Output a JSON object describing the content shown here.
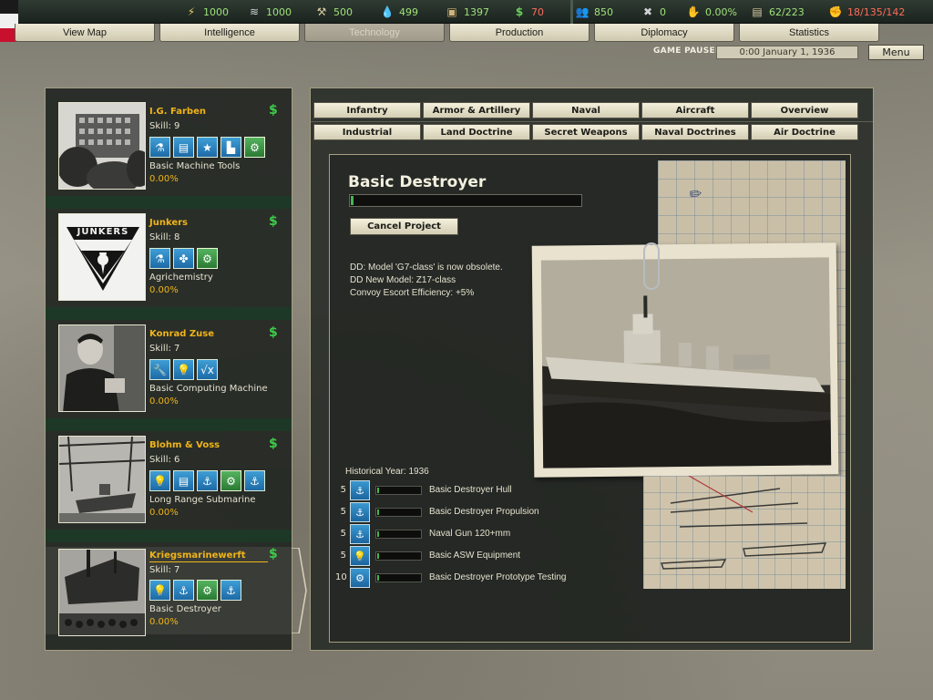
{
  "topbar": {
    "resources": [
      {
        "icon": "energy-icon",
        "value": "1000"
      },
      {
        "icon": "metal-icon",
        "value": "1000"
      },
      {
        "icon": "rare-materials-icon",
        "value": "500"
      },
      {
        "icon": "oil-icon",
        "value": "499"
      },
      {
        "icon": "supplies-icon",
        "value": "1397"
      },
      {
        "icon": "money-icon",
        "value": "70"
      },
      {
        "icon": "manpower-icon",
        "value": "850"
      },
      {
        "icon": "diplomacy-icon",
        "value": "0"
      },
      {
        "icon": "dissent-icon",
        "value": "0.00%"
      },
      {
        "icon": "transports-icon",
        "value": "62/223"
      },
      {
        "icon": "industry-icon",
        "value": "18/135/142"
      }
    ]
  },
  "tabs": [
    "View Map",
    "Intelligence",
    "Technology",
    "Production",
    "Diplomacy",
    "Statistics"
  ],
  "active_tab": "Technology",
  "status": {
    "paused": "GAME PAUSED",
    "date": "0:00 January 1, 1936",
    "menu": "Menu"
  },
  "tech_categories_row1": [
    "Infantry",
    "Armor & Artillery",
    "Naval",
    "Aircraft",
    "Overview"
  ],
  "tech_categories_row2": [
    "Industrial",
    "Land Doctrine",
    "Secret Weapons",
    "Naval Doctrines",
    "Air Doctrine"
  ],
  "teams": [
    {
      "name": "I.G. Farben",
      "skill": "Skill: 9",
      "project": "Basic Machine Tools",
      "progress": "0.00%",
      "dollar": "$",
      "icons": [
        "chemistry-icon",
        "computing-icon",
        "star-icon",
        "industry-icon",
        "gears-icon"
      ]
    },
    {
      "name": "Junkers",
      "skill": "Skill: 8",
      "project": "Agrichemistry",
      "progress": "0.00%",
      "dollar": "$",
      "icons": [
        "chemistry-icon",
        "propeller-icon",
        "gears-icon"
      ]
    },
    {
      "name": "Konrad Zuse",
      "skill": "Skill: 7",
      "project": "Basic Computing Machine",
      "progress": "0.00%",
      "dollar": "$",
      "icons": [
        "wrench-icon",
        "lightbulb-icon",
        "math-icon"
      ]
    },
    {
      "name": "Blohm & Voss",
      "skill": "Skill: 6",
      "project": "Long Range Submarine",
      "progress": "0.00%",
      "dollar": "$",
      "icons": [
        "lightbulb-icon",
        "computing-icon",
        "anchor-icon",
        "gears-icon",
        "anchor-gun-icon"
      ]
    },
    {
      "name": "Kriegsmarinewerft",
      "skill": "Skill: 7",
      "project": "Basic Destroyer",
      "progress": "0.00%",
      "dollar": "$",
      "icons": [
        "lightbulb-icon",
        "anchor-icon",
        "gears-icon",
        "anchor-gun-icon"
      ]
    }
  ],
  "project": {
    "title": "Basic Destroyer",
    "progress_fraction": 0.01,
    "cancel": "Cancel Project",
    "effects": [
      "DD: Model 'G7-class' is now obsolete.",
      "DD New Model: Z17-class",
      "Convoy Escort Efficiency: +5%"
    ],
    "historical_year": "Historical Year: 1936",
    "components": [
      {
        "difficulty": "5",
        "icon": "anchor-icon",
        "name": "Basic Destroyer Hull",
        "progress_fraction": 0.02
      },
      {
        "difficulty": "5",
        "icon": "anchor-icon",
        "name": "Basic Destroyer Propulsion",
        "progress_fraction": 0.02
      },
      {
        "difficulty": "5",
        "icon": "anchor-gun-icon",
        "name": "Naval Gun 120+mm",
        "progress_fraction": 0.02
      },
      {
        "difficulty": "5",
        "icon": "lightbulb-icon",
        "name": "Basic ASW Equipment",
        "progress_fraction": 0.02
      },
      {
        "difficulty": "10",
        "icon": "gears-icon",
        "name": "Basic Destroyer Prototype Testing",
        "progress_fraction": 0.02
      }
    ]
  },
  "logos": {
    "junkers": "JUNKERS"
  },
  "colors": {
    "accent_gold": "#f0b418",
    "resource_green": "#9fe27a",
    "alert_red": "#ff6a5a",
    "money_green": "#3ecb49",
    "progress_green": "#47b552"
  }
}
